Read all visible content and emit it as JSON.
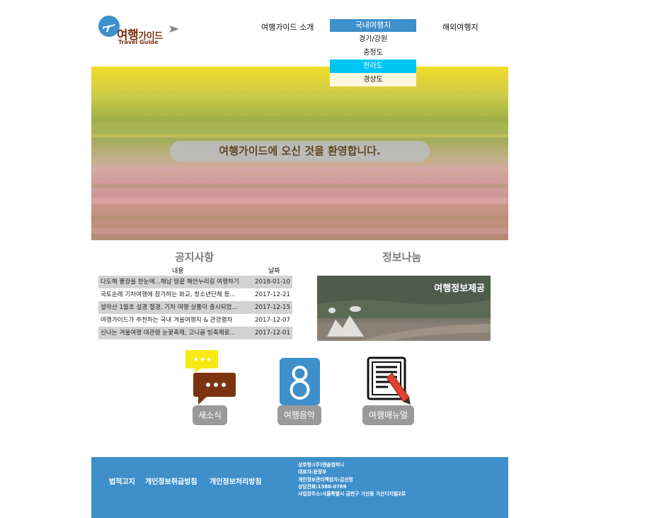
{
  "header": {
    "logo": {
      "brand_big": "여행",
      "brand_small": "가이드",
      "sub": "Travel Guide"
    },
    "nav": {
      "intro": "여행가이드 소개",
      "domestic": "국내여행지",
      "overseas": "해외여행지"
    },
    "dropdown": [
      "경기/강원",
      "충청도",
      "전라도",
      "경상도"
    ]
  },
  "hero": {
    "welcome": "여행가이드에 오신 것을 환영합니다."
  },
  "notices": {
    "title": "공지사항",
    "col_content": "내용",
    "col_date": "날짜",
    "rows": [
      {
        "text": "다도해 풍광을 한눈에...해남 땅끝 해안누리길 여행하기",
        "date": "2018-01-10"
      },
      {
        "text": "국토순례 기차여행에 참가하는 화교, 청소년단체 등...",
        "date": "2017-12-21"
      },
      {
        "text": "설악산 1월초 설경 절경, 기차 여행 상품이 출시되었...",
        "date": "2017-12-15"
      },
      {
        "text": "여행가이드가 추천하는 국내 겨울여행지 & 관광열차",
        "date": "2017-12-07"
      },
      {
        "text": "신나는 겨울여행 대관령 눈꽃축제, 고니골 빙축제로...",
        "date": "2017-12-01"
      }
    ]
  },
  "info_share": {
    "title": "정보나눔",
    "image_label": "여행정보제공"
  },
  "quick_links": [
    {
      "label": "새소식",
      "icon": "speech-bubbles-icon"
    },
    {
      "label": "여행음악",
      "icon": "music-8-icon"
    },
    {
      "label": "여행매뉴얼",
      "icon": "document-pencil-icon"
    }
  ],
  "footer": {
    "links": [
      "법적고지",
      "개인정보취급방침",
      "개인정보처리방침"
    ],
    "info": [
      "상호명:(주)엔솔컴퍼니",
      "대표자:윤정우",
      "개인정보관리책임자:김선영",
      "상담전화:1588-0789",
      "사업장주소:서울특별시 금천구 가산동 가산디지털2로"
    ]
  },
  "colors": {
    "primary_blue": "#3e8fca",
    "dropdown_active": "#00c6f4",
    "logo_brown": "#7a3210",
    "pill_gray": "#9a9a9a"
  }
}
